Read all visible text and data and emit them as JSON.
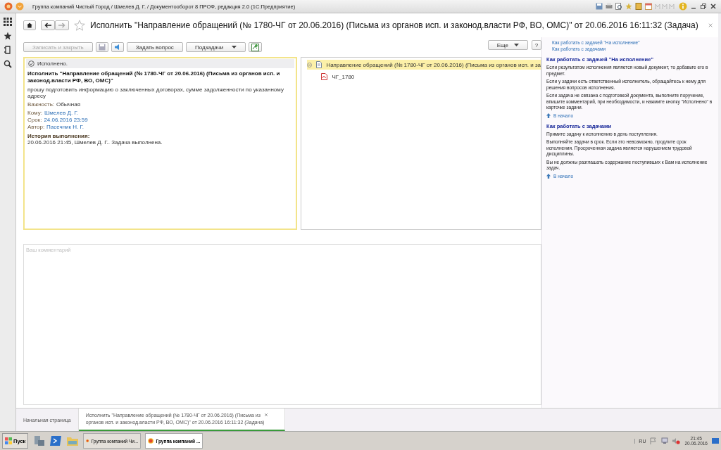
{
  "window": {
    "title": "Группа компаний Чистый Город / Шмелев Д. Г. / Документооборот 8 ПРОФ, редакция 2.0  (1С:Предприятие)"
  },
  "form": {
    "title": "Исполнить \"Направление обращений (№ 1780-ЧГ от 20.06.2016) (Письма из органов исп. и законод.власти РФ, ВО, ОМС)\" от 20.06.2016 16:11:32 (Задача)",
    "favorite": false
  },
  "toolbar": {
    "buttons": [
      {
        "kind": "text",
        "label": "Записать и закрыть",
        "disabled": true
      },
      {
        "kind": "save",
        "disabled": true
      },
      {
        "kind": "sound",
        "disabled": false
      },
      {
        "kind": "text",
        "label": "Задать вопрос",
        "disabled": false
      },
      {
        "kind": "menu",
        "label": "Подзадачи",
        "disabled": false
      },
      {
        "kind": "add",
        "disabled": false
      }
    ],
    "more": "Еще",
    "help": "?"
  },
  "task": {
    "status": "Исполнено.",
    "heading": "Исполнить \"Направление обращений (№ 1780-ЧГ от 20.06.2016) (Письма из органов исп. и законод.власти РФ, ВО, ОМС)\"",
    "description": "прошу подготовить информацию о заключенных договорах, сумме задолженности по указанному адресу",
    "importance": {
      "label": "Важность:",
      "value": "Обычная"
    },
    "fields": [
      {
        "label": "Кому:",
        "value": "Шмелев Д. Г."
      },
      {
        "label": "Срок:",
        "value": "24.06.2016 23:59"
      },
      {
        "label": "Автор:",
        "value": "Пасечник Н. Г."
      }
    ],
    "history_title": "История выполнения:",
    "history": "20.06.2016 21:45, Шмелев Д. Г.. Задача выполнена."
  },
  "subjects": {
    "items": [
      {
        "label": "Направление обращений (№ 1780-ЧГ от 20.06.2016) (Письма из органов исп. и за",
        "expanded": true,
        "selected": true,
        "children": [
          {
            "label": "ЧГ_1780",
            "selected": false
          }
        ]
      }
    ]
  },
  "comment": {
    "placeholder": "Ваш комментарий"
  },
  "help": {
    "links": [
      "Как работать с задачей \"На исполнение\"",
      "Как работать с задачами"
    ],
    "sections": [
      {
        "title": "Как работать с задачей \"На исполнение\"",
        "paragraphs": [
          "Если результатом исполнения является новый документ, то добавьте его в предмет.",
          "Если у задачи есть ответственный исполнитель, обращайтесь к нему для решения вопросов исполнения.",
          "Если задача не связана с подготовкой документа, выполните поручение, впишите комментарий, при необходимости, и нажмите кнопку \"Исполнено\" в карточке задачи."
        ],
        "top": "В начало"
      },
      {
        "title": "Как работать с задачами",
        "paragraphs": [
          "Примите задачу к исполнению в день поступления.",
          "Выполняйте задачи в срок. Если это невозможно, продлите срок исполнения. Просроченная задача является нарушением трудовой дисциплины.",
          "Вы не должны разглашать содержание поступивших к Вам на исполнение задач."
        ],
        "top": "В начало"
      }
    ]
  },
  "open_tabs": [
    {
      "label": "Начальная страница",
      "selected": false
    },
    {
      "label": "Исполнить \"Направление обращений (№ 1780-ЧГ от 20.06.2016) (Письма из органов исп. и законод.власти РФ, ВО, ОМС)\" от 20.06.2016 16:11:32 (Задача)",
      "selected": true
    }
  ],
  "taskbar": {
    "start": "Пуск",
    "windows": [
      {
        "label": "Группа компаний Чи...",
        "selected": false
      },
      {
        "label": "Группа компаний ...",
        "selected": true
      }
    ],
    "language": "RU",
    "time": "21:45",
    "date": "20.06.2016"
  }
}
